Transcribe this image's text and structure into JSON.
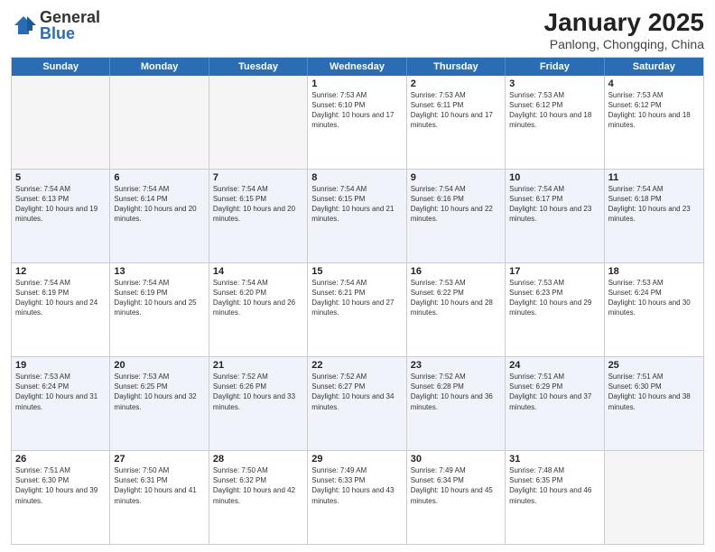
{
  "header": {
    "logo": {
      "general": "General",
      "blue": "Blue"
    },
    "title": "January 2025",
    "location": "Panlong, Chongqing, China"
  },
  "weekdays": [
    "Sunday",
    "Monday",
    "Tuesday",
    "Wednesday",
    "Thursday",
    "Friday",
    "Saturday"
  ],
  "rows": [
    [
      {
        "day": "",
        "empty": true
      },
      {
        "day": "",
        "empty": true
      },
      {
        "day": "",
        "empty": true
      },
      {
        "day": "1",
        "sunrise": "7:53 AM",
        "sunset": "6:10 PM",
        "daylight": "10 hours and 17 minutes."
      },
      {
        "day": "2",
        "sunrise": "7:53 AM",
        "sunset": "6:11 PM",
        "daylight": "10 hours and 17 minutes."
      },
      {
        "day": "3",
        "sunrise": "7:53 AM",
        "sunset": "6:12 PM",
        "daylight": "10 hours and 18 minutes."
      },
      {
        "day": "4",
        "sunrise": "7:53 AM",
        "sunset": "6:12 PM",
        "daylight": "10 hours and 18 minutes."
      }
    ],
    [
      {
        "day": "5",
        "sunrise": "7:54 AM",
        "sunset": "6:13 PM",
        "daylight": "10 hours and 19 minutes."
      },
      {
        "day": "6",
        "sunrise": "7:54 AM",
        "sunset": "6:14 PM",
        "daylight": "10 hours and 20 minutes."
      },
      {
        "day": "7",
        "sunrise": "7:54 AM",
        "sunset": "6:15 PM",
        "daylight": "10 hours and 20 minutes."
      },
      {
        "day": "8",
        "sunrise": "7:54 AM",
        "sunset": "6:15 PM",
        "daylight": "10 hours and 21 minutes."
      },
      {
        "day": "9",
        "sunrise": "7:54 AM",
        "sunset": "6:16 PM",
        "daylight": "10 hours and 22 minutes."
      },
      {
        "day": "10",
        "sunrise": "7:54 AM",
        "sunset": "6:17 PM",
        "daylight": "10 hours and 23 minutes."
      },
      {
        "day": "11",
        "sunrise": "7:54 AM",
        "sunset": "6:18 PM",
        "daylight": "10 hours and 23 minutes."
      }
    ],
    [
      {
        "day": "12",
        "sunrise": "7:54 AM",
        "sunset": "6:19 PM",
        "daylight": "10 hours and 24 minutes."
      },
      {
        "day": "13",
        "sunrise": "7:54 AM",
        "sunset": "6:19 PM",
        "daylight": "10 hours and 25 minutes."
      },
      {
        "day": "14",
        "sunrise": "7:54 AM",
        "sunset": "6:20 PM",
        "daylight": "10 hours and 26 minutes."
      },
      {
        "day": "15",
        "sunrise": "7:54 AM",
        "sunset": "6:21 PM",
        "daylight": "10 hours and 27 minutes."
      },
      {
        "day": "16",
        "sunrise": "7:53 AM",
        "sunset": "6:22 PM",
        "daylight": "10 hours and 28 minutes."
      },
      {
        "day": "17",
        "sunrise": "7:53 AM",
        "sunset": "6:23 PM",
        "daylight": "10 hours and 29 minutes."
      },
      {
        "day": "18",
        "sunrise": "7:53 AM",
        "sunset": "6:24 PM",
        "daylight": "10 hours and 30 minutes."
      }
    ],
    [
      {
        "day": "19",
        "sunrise": "7:53 AM",
        "sunset": "6:24 PM",
        "daylight": "10 hours and 31 minutes."
      },
      {
        "day": "20",
        "sunrise": "7:53 AM",
        "sunset": "6:25 PM",
        "daylight": "10 hours and 32 minutes."
      },
      {
        "day": "21",
        "sunrise": "7:52 AM",
        "sunset": "6:26 PM",
        "daylight": "10 hours and 33 minutes."
      },
      {
        "day": "22",
        "sunrise": "7:52 AM",
        "sunset": "6:27 PM",
        "daylight": "10 hours and 34 minutes."
      },
      {
        "day": "23",
        "sunrise": "7:52 AM",
        "sunset": "6:28 PM",
        "daylight": "10 hours and 36 minutes."
      },
      {
        "day": "24",
        "sunrise": "7:51 AM",
        "sunset": "6:29 PM",
        "daylight": "10 hours and 37 minutes."
      },
      {
        "day": "25",
        "sunrise": "7:51 AM",
        "sunset": "6:30 PM",
        "daylight": "10 hours and 38 minutes."
      }
    ],
    [
      {
        "day": "26",
        "sunrise": "7:51 AM",
        "sunset": "6:30 PM",
        "daylight": "10 hours and 39 minutes."
      },
      {
        "day": "27",
        "sunrise": "7:50 AM",
        "sunset": "6:31 PM",
        "daylight": "10 hours and 41 minutes."
      },
      {
        "day": "28",
        "sunrise": "7:50 AM",
        "sunset": "6:32 PM",
        "daylight": "10 hours and 42 minutes."
      },
      {
        "day": "29",
        "sunrise": "7:49 AM",
        "sunset": "6:33 PM",
        "daylight": "10 hours and 43 minutes."
      },
      {
        "day": "30",
        "sunrise": "7:49 AM",
        "sunset": "6:34 PM",
        "daylight": "10 hours and 45 minutes."
      },
      {
        "day": "31",
        "sunrise": "7:48 AM",
        "sunset": "6:35 PM",
        "daylight": "10 hours and 46 minutes."
      },
      {
        "day": "",
        "empty": true
      }
    ]
  ],
  "labels": {
    "sunrise": "Sunrise:",
    "sunset": "Sunset:",
    "daylight": "Daylight:"
  }
}
